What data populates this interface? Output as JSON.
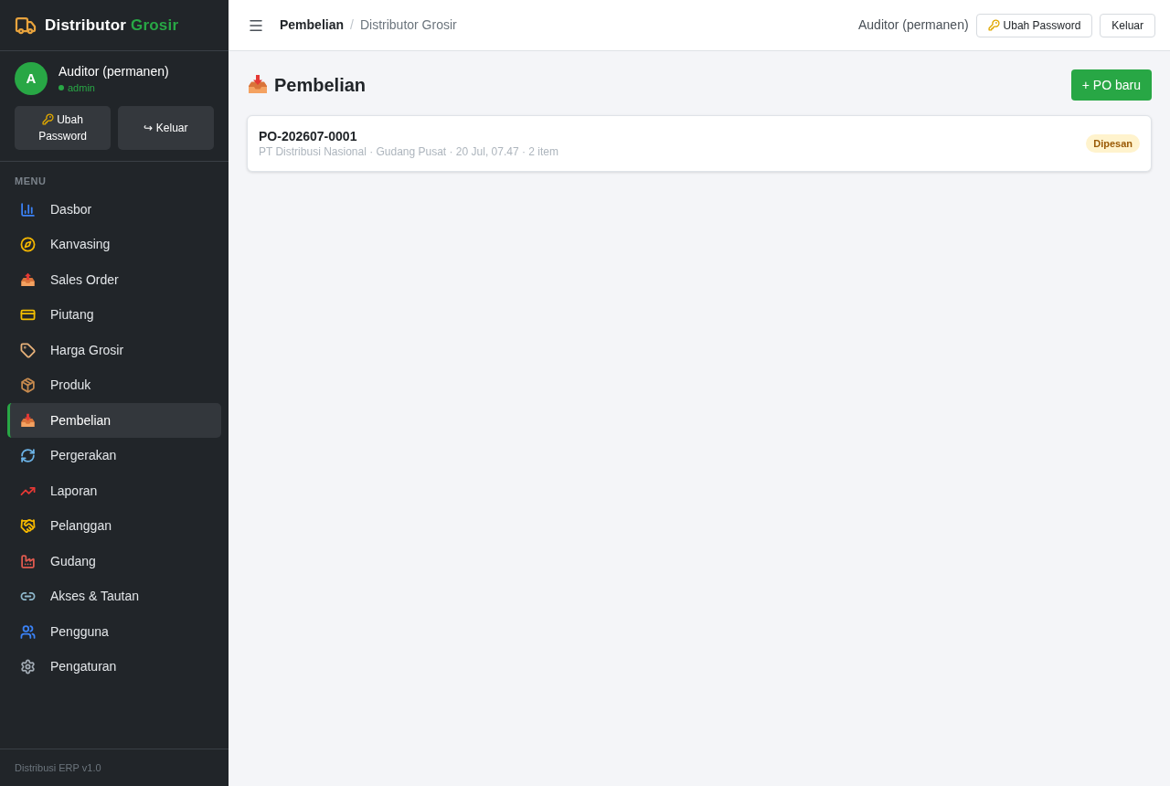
{
  "sidebar": {
    "brand": {
      "name": "Distributor",
      "accent": "Grosir"
    },
    "user": {
      "initial": "A",
      "name": "Auditor (permanen)",
      "role": "admin",
      "buttons": [
        {
          "label": "Ubah Password",
          "kind": "password"
        },
        {
          "label": "↪ Keluar",
          "kind": "logout"
        }
      ]
    },
    "menu": {
      "heading": "MENU",
      "items": [
        {
          "label": "Dasbor",
          "selected": false
        },
        {
          "label": "Kanvasing",
          "selected": false
        },
        {
          "label": "Sales Order",
          "selected": false
        },
        {
          "label": "Piutang",
          "selected": false
        },
        {
          "label": "Harga Grosir",
          "selected": false
        },
        {
          "label": "Produk",
          "selected": false
        },
        {
          "label": "Pembelian",
          "selected": true
        },
        {
          "label": "Pergerakan",
          "selected": false
        },
        {
          "label": "Laporan",
          "selected": false
        },
        {
          "label": "Pelanggan",
          "selected": false
        },
        {
          "label": "Gudang",
          "selected": false
        },
        {
          "label": "Akses & Tautan",
          "selected": false
        },
        {
          "label": "Pengguna",
          "selected": false
        },
        {
          "label": "Pengaturan",
          "selected": false
        }
      ]
    },
    "footer": "Distribusi ERP v1.0"
  },
  "header": {
    "breadcrumb": {
      "current": "Pembelian",
      "separator": "/",
      "parent": "Distributor Grosir"
    },
    "user_name": "Auditor (permanen)",
    "buttons": [
      {
        "label": "Ubah Password",
        "kind": "password"
      },
      {
        "label": "Keluar",
        "kind": "logout"
      }
    ]
  },
  "page": {
    "title": "Pembelian",
    "new_button": "+ PO baru",
    "orders": [
      {
        "number": "PO-202607-0001",
        "meta": "PT Distribusi Nasional · Gudang Pusat · 20 Jul, 07.47 · 2 item",
        "status": "Dipesan"
      }
    ]
  }
}
